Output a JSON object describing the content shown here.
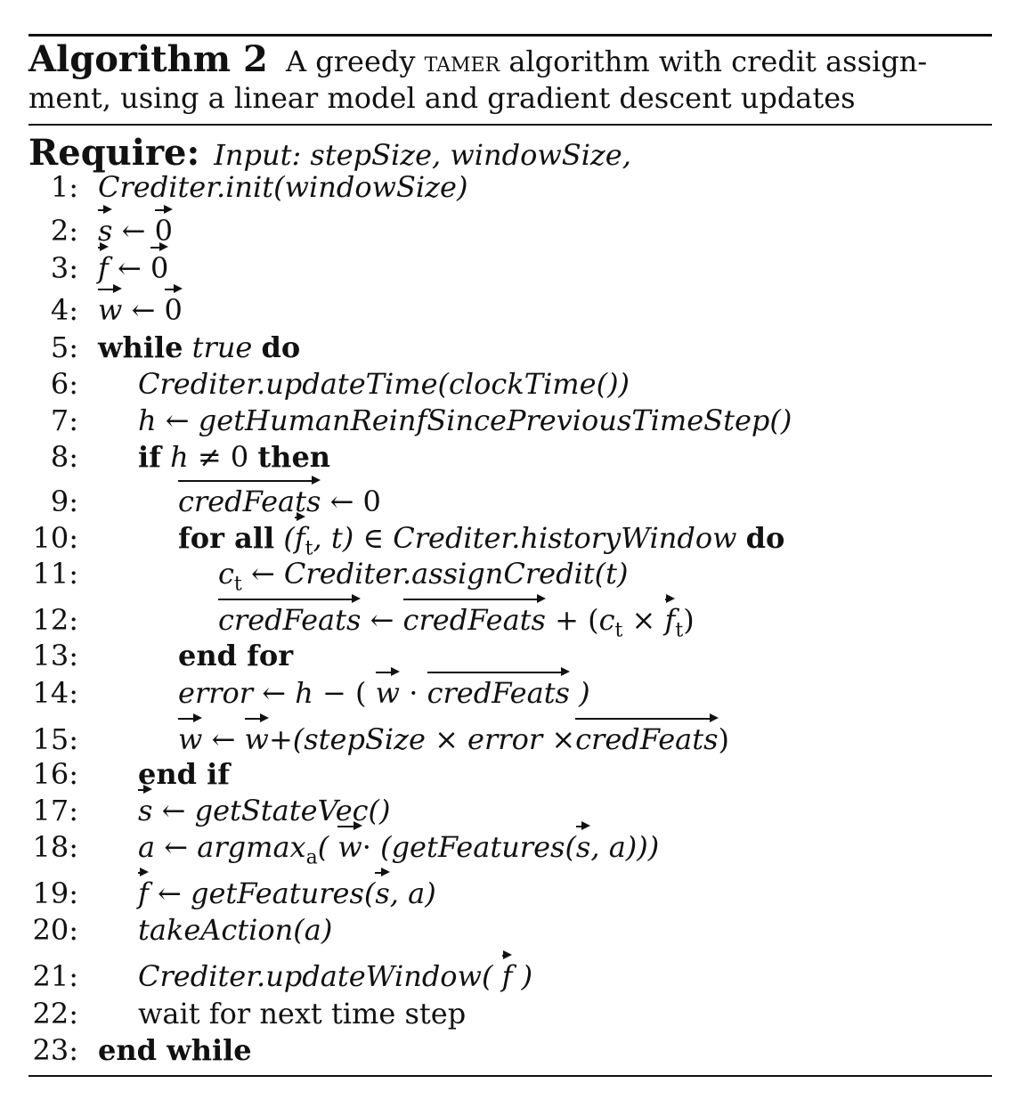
{
  "caption": {
    "label": "Algorithm 2",
    "text_before": "A greedy",
    "small_caps": "tamer",
    "text_after": "algorithm with credit assign- ment, using a linear model and gradient descent updates"
  },
  "require": {
    "keyword": "Require:",
    "text": "Input: stepSize, windowSize,"
  },
  "lines": [
    {
      "n": "1:",
      "parts": {
        "a": "Crediter.init(windowSize)"
      }
    },
    {
      "n": "2:",
      "parts": {
        "v1": "s",
        "arrow": "←",
        "v2": "0"
      }
    },
    {
      "n": "3:",
      "parts": {
        "v1": "f",
        "arrow": "←",
        "v2": "0"
      }
    },
    {
      "n": "4:",
      "parts": {
        "v1": "w",
        "arrow": "←",
        "v2": "0"
      }
    },
    {
      "n": "5:",
      "parts": {
        "k1": "while",
        "a": "true",
        "k2": "do"
      }
    },
    {
      "n": "6:",
      "parts": {
        "a": "Crediter.updateTime(clockTime())"
      }
    },
    {
      "n": "7:",
      "parts": {
        "a": "h",
        "arrow": "←",
        "b": "getHumanReinfSincePreviousTimeStep()"
      }
    },
    {
      "n": "8:",
      "parts": {
        "k1": "if",
        "a": "h",
        "op": "≠ 0",
        "k2": "then"
      }
    },
    {
      "n": "9:",
      "parts": {
        "v1": "credFeats",
        "arrow": "← 0"
      }
    },
    {
      "n": "10:",
      "parts": {
        "k1": "for all",
        "p1": "(",
        "v1": "f",
        "sub": "t",
        "a": ", t)",
        "op": "∈",
        "b": "Crediter.historyWindow",
        "k2": "do"
      }
    },
    {
      "n": "11:",
      "parts": {
        "a": "c",
        "sub": "t",
        "arrow": "←",
        "b": "Crediter.assignCredit(t)"
      }
    },
    {
      "n": "12:",
      "parts": {
        "v1": "credFeats",
        "arrow": "←",
        "v2": "credFeats",
        "op": "+ (",
        "a": "c",
        "sub": "t",
        "x": "×",
        "v3": "f",
        "sub2": "t",
        "p2": ")"
      }
    },
    {
      "n": "13:",
      "parts": {
        "k1": "end for"
      }
    },
    {
      "n": "14:",
      "parts": {
        "a": "error",
        "arrow": "←",
        "b": "h",
        "op": "− (",
        "v1": "w",
        "dot": "·",
        "v2": "credFeats",
        "p2": ")"
      }
    },
    {
      "n": "15:",
      "parts": {
        "v1": "w",
        "arrow": "←",
        "v2": "w",
        "op": "+(",
        "a": "stepSize",
        "x": "×",
        "b": "error",
        "x2": "×",
        "v3": "credFeats",
        "p2": ")"
      }
    },
    {
      "n": "16:",
      "parts": {
        "k1": "end if"
      }
    },
    {
      "n": "17:",
      "parts": {
        "v1": "s",
        "arrow": "←",
        "a": "getStateVec()"
      }
    },
    {
      "n": "18:",
      "parts": {
        "a": "a",
        "arrow": "←",
        "b": "argmax",
        "sub": "a",
        "p1": "(",
        "v1": "w",
        "dot": "·",
        "c": "(getFeatures(",
        "v2": "s",
        "d": ", a)))"
      }
    },
    {
      "n": "19:",
      "parts": {
        "v1": "f",
        "arrow": "←",
        "a": "getFeatures(",
        "v2": "s",
        "b": ", a)"
      }
    },
    {
      "n": "20:",
      "parts": {
        "a": "takeAction(a)"
      }
    },
    {
      "n": "21:",
      "parts": {
        "a": "Crediter.updateWindow(",
        "v1": "f",
        "b": ")"
      }
    },
    {
      "n": "22:",
      "parts": {
        "a": "wait for next time step"
      }
    },
    {
      "n": "23:",
      "parts": {
        "k1": "end while"
      }
    }
  ]
}
